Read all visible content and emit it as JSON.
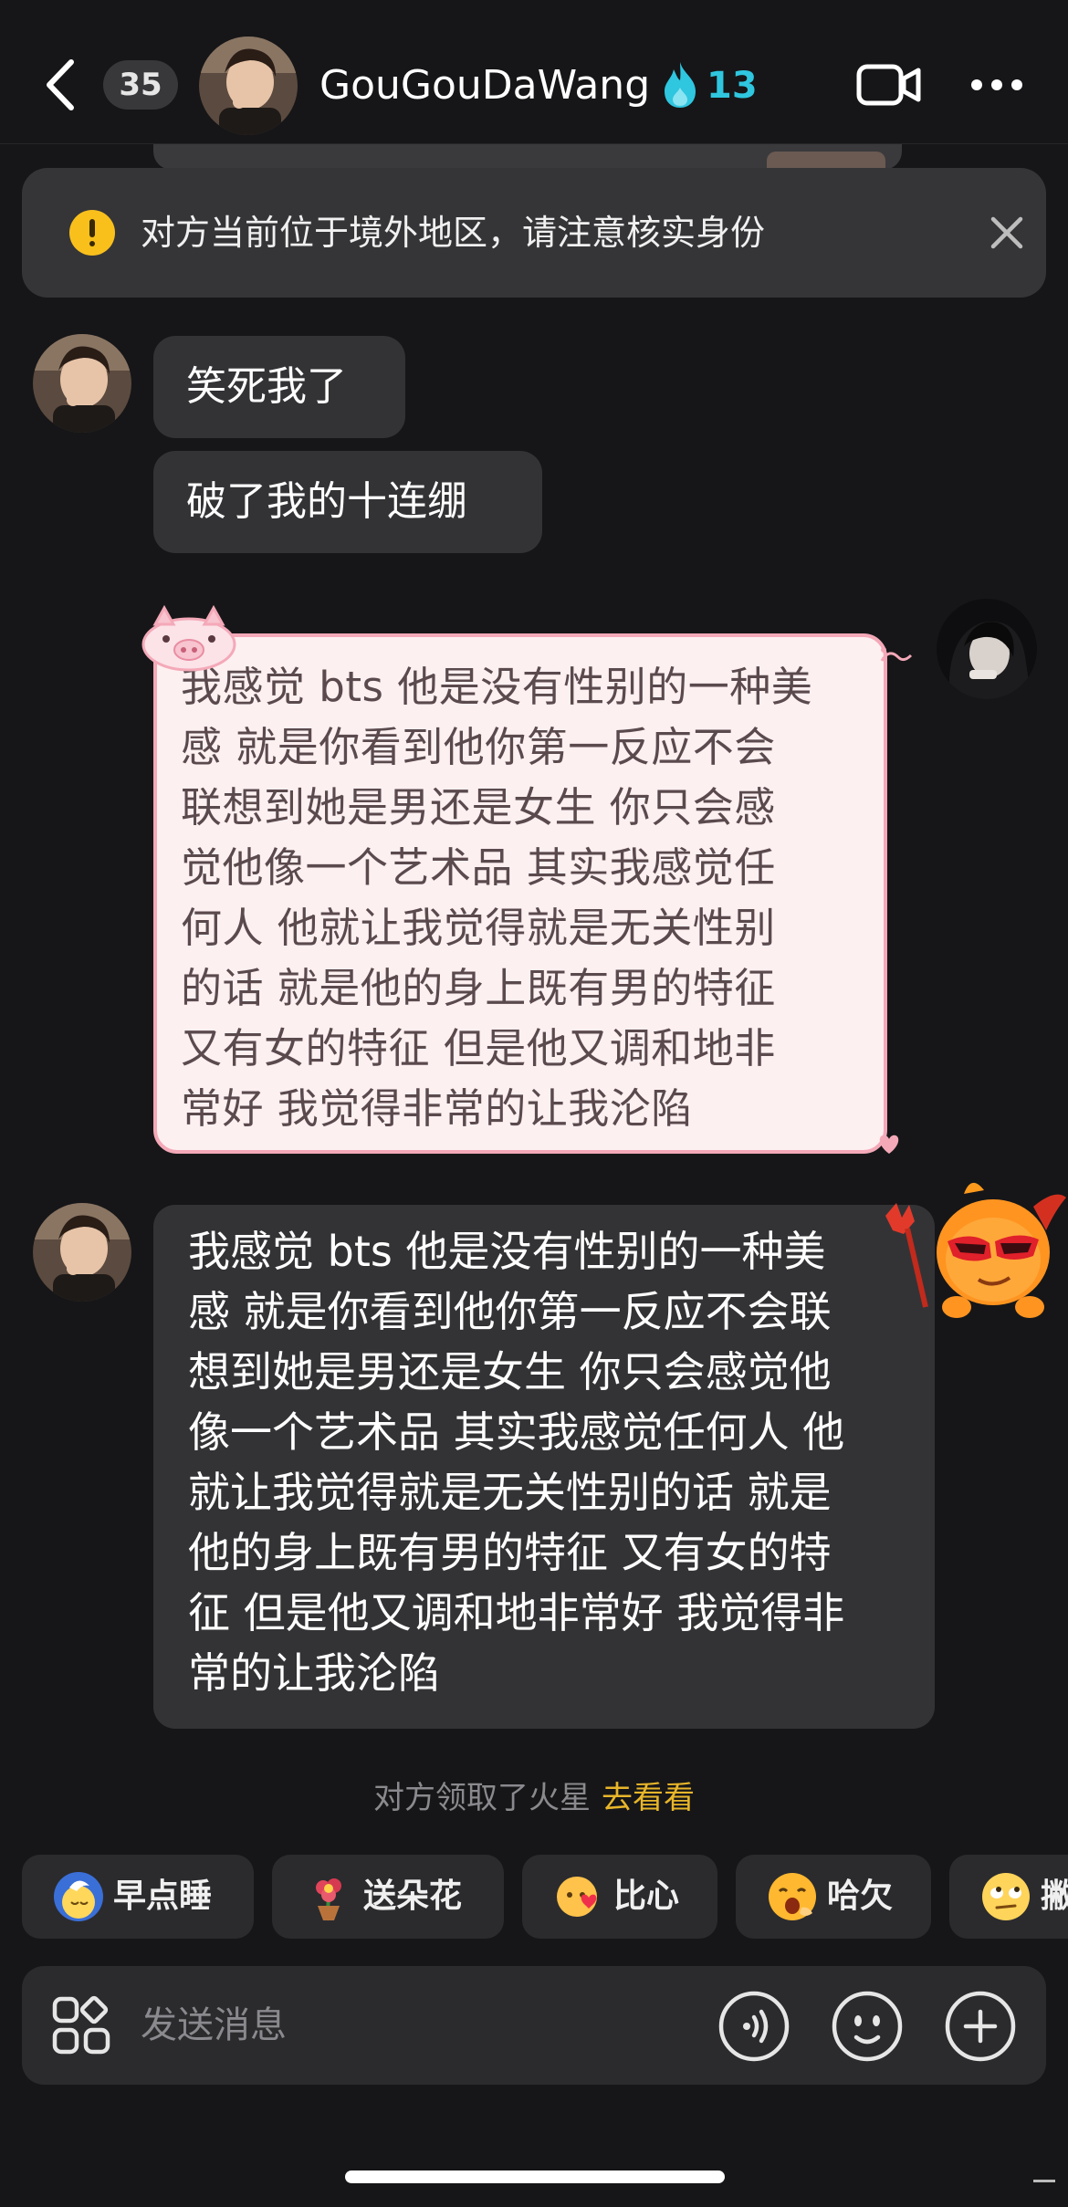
{
  "header": {
    "unread_count": "35",
    "contact_name": "GouGouDaWang",
    "spark_count": "13",
    "icons": {
      "back": "chevron-left-icon",
      "flame": "flame-icon",
      "video": "video-call-icon",
      "more": "ellipsis-icon"
    }
  },
  "warning": {
    "text": "对方当前位于境外地区，请注意核实身份",
    "icon": "warning-icon",
    "close_icon": "close-icon"
  },
  "messages": [
    {
      "side": "left",
      "text": "笑死我了"
    },
    {
      "side": "left",
      "text": "破了我的十连绷"
    },
    {
      "side": "right",
      "style": "pink",
      "lines": [
        "我感觉 bts 他是没有性别的一种美",
        "感 就是你看到他你第一反应不会",
        "联想到她是男还是女生 你只会感",
        "觉他像一个艺术品 其实我感觉任",
        "何人 他就让我觉得就是无关性别",
        "的话 就是他的身上既有男的特征",
        "又有女的特征 但是他又调和地非",
        "常好 我觉得非常的让我沦陷"
      ]
    },
    {
      "side": "left",
      "lines": [
        "我感觉 bts 他是没有性别的一种美",
        "感 就是你看到他你第一反应不会联",
        "想到她是男还是女生 你只会感觉他",
        "像一个艺术品 其实我感觉任何人 他",
        "就让我觉得就是无关性别的话 就是",
        "他的身上既有男的特征 又有女的特",
        "征 但是他又调和地非常好 我觉得非",
        "常的让我沦陷"
      ]
    }
  ],
  "system_notice": {
    "text": "对方领取了火星",
    "link": "去看看"
  },
  "quick_replies": [
    {
      "label": "早点睡",
      "icon": "moon-sleep-emoji"
    },
    {
      "label": "送朵花",
      "icon": "flower-emoji"
    },
    {
      "label": "比心",
      "icon": "heart-hands-emoji"
    },
    {
      "label": "哈欠",
      "icon": "yawn-emoji"
    },
    {
      "label": "撇",
      "icon": "eye-roll-emoji"
    }
  ],
  "input": {
    "placeholder": "发送消息",
    "icons": {
      "apps": "apps-grid-icon",
      "voice": "voice-icon",
      "emoji": "emoji-icon",
      "plus": "plus-icon"
    }
  },
  "colors": {
    "background": "#161618",
    "bubble": "#333336",
    "pink_bubble": "#fdf0f1",
    "pink_border": "#f4a9b8",
    "spark": "#2fc6df",
    "link": "#e8b62a",
    "warning": "#f9c01c"
  }
}
